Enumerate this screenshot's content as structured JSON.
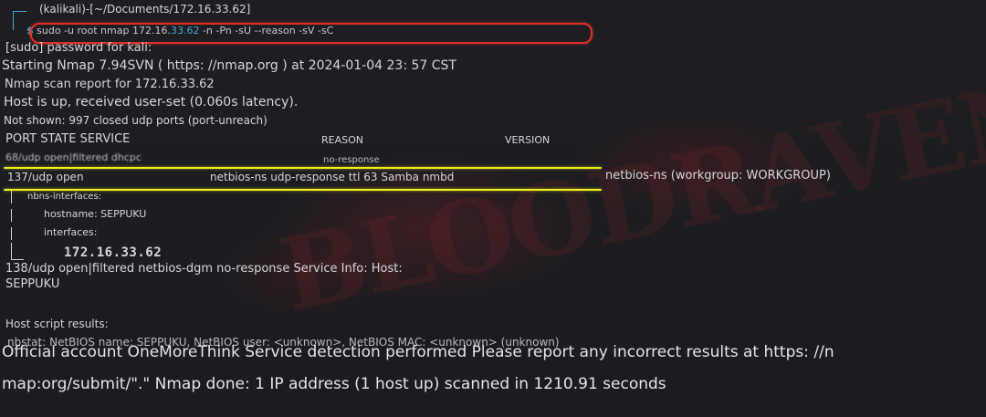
{
  "prompt": {
    "header": "(kalikali)-[~/Documents/172.16.33.62]",
    "dollar": "$",
    "command_prefix": "sudo -u root nmap 172.16.",
    "command_ip_highlight": "33.62",
    "command_suffix": " -n -Pn -sU --reason -sV -sC"
  },
  "output": {
    "sudo_prompt": "[sudo] password for kali:",
    "starting": "Starting Nmap 7.94SVN ( https: //nmap.org ) at 2024-01-04 23: 57 CST",
    "report_for": "Nmap scan report for 172.16.33.62",
    "host_up": "Host is up, received user-set (0.060s latency).",
    "not_shown": "Not shown: 997 closed udp ports (port-unreach)",
    "table_header": {
      "port_state_service": "PORT STATE SERVICE",
      "reason": "REASON",
      "version": "VERSION"
    },
    "row_68": {
      "left": "68/udp open|filtered dhcpc",
      "reason": "no-response"
    },
    "row_137": {
      "port_state": "137/udp open",
      "service_reason": "netbios-ns udp-response ttl 63 Samba nmbd",
      "version": "netbios-ns (workgroup: WORKGROUP)"
    },
    "nbns": {
      "title": "nbns-interfaces:",
      "hostname": "hostname: SEPPUKU",
      "interfaces": "interfaces:",
      "ip": "172.16.33.62"
    },
    "row_138_line1": "138/udp open|filtered netbios-dgm no-response Service Info:  Host:",
    "row_138_line2": "SEPPUKU",
    "host_script": "Host script results:",
    "nbstat": "nbstat:  NetBIOS name: SEPPUKU, NetBIOS user: <unknown>, NetBIOS MAC: <unknown> (unknown)"
  },
  "footer": {
    "line1": "Official account OneMoreThink Service detection performed Please report any incorrect results at https: //n",
    "line2": "map:org/submit/\".\" Nmap done: 1 IP address (1 host up) scanned in 1210.91 seconds"
  },
  "colors": {
    "background": "#1b1d21",
    "prompt_accent": "#4aa8d8",
    "red_annotation": "#e0302a",
    "yellow_annotation": "#f2f01e"
  }
}
